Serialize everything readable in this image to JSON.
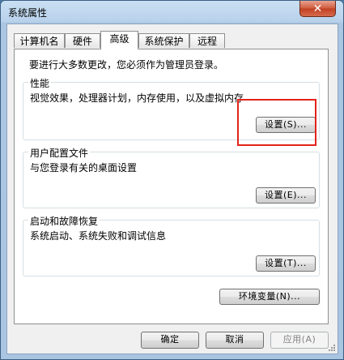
{
  "window": {
    "title": "系统属性",
    "close_glyph": "✕"
  },
  "tabs": [
    {
      "label": "计算机名"
    },
    {
      "label": "硬件"
    },
    {
      "label": "高级"
    },
    {
      "label": "系统保护"
    },
    {
      "label": "远程"
    }
  ],
  "advanced": {
    "admin_note": "要进行大多数更改，您必须作为管理员登录。",
    "performance": {
      "title": "性能",
      "description": "视觉效果，处理器计划，内存使用，以及虚拟内存",
      "button": "设置(S)..."
    },
    "user_profiles": {
      "title": "用户配置文件",
      "description": "与您登录有关的桌面设置",
      "button": "设置(E)..."
    },
    "startup_recovery": {
      "title": "启动和故障恢复",
      "description": "系统启动、系统失败和调试信息",
      "button": "设置(T)..."
    },
    "env_button": "环境变量(N)..."
  },
  "footer": {
    "ok": "确定",
    "cancel": "取消",
    "apply": "应用(A)"
  },
  "colors": {
    "highlight": "#e2231a",
    "title_bar": "#b8d1ea",
    "close_button": "#c13f22"
  }
}
